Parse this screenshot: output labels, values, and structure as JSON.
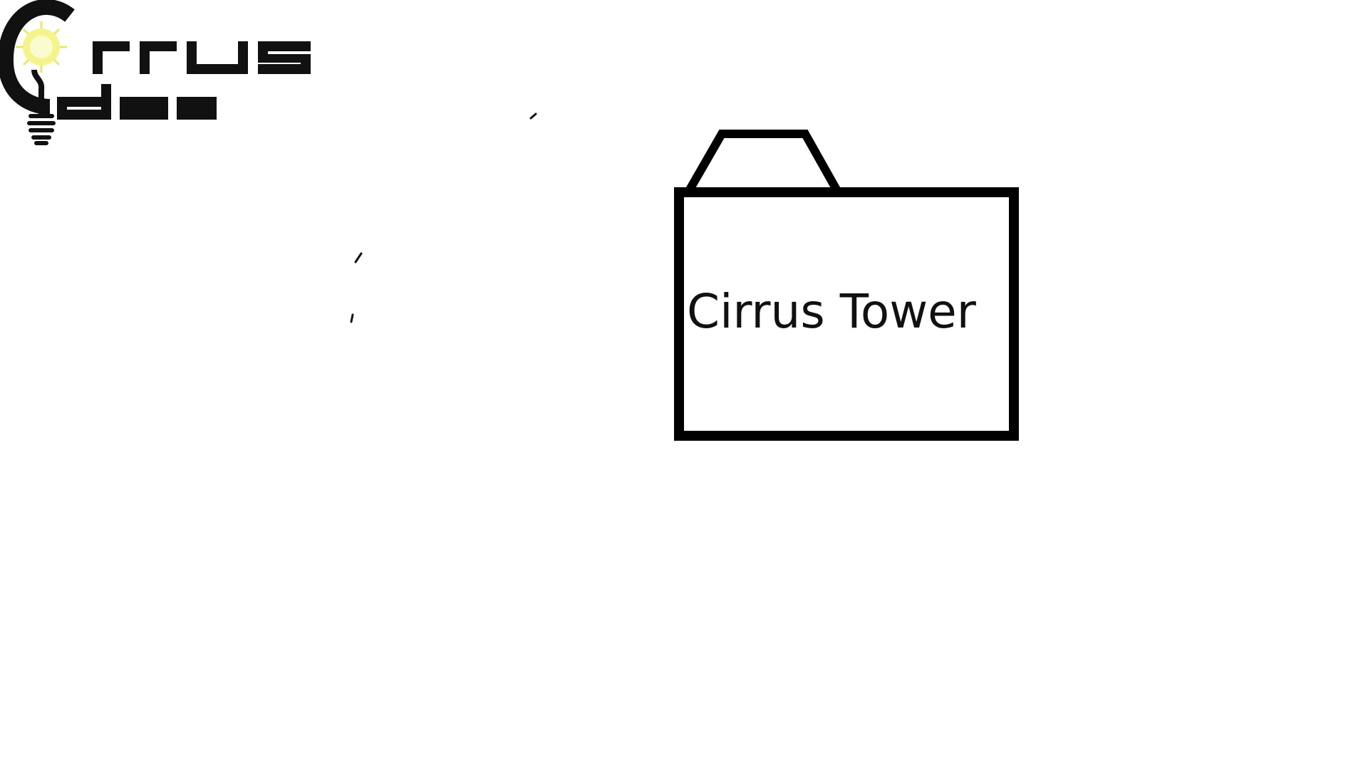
{
  "logo": {
    "text": "Cirrus Idea",
    "line1": "rrus",
    "line2": "dea",
    "colors": {
      "ink": "#111111",
      "bulb_glow": "#f4f48a",
      "bulb_core": "#fbfbd0"
    }
  },
  "folder": {
    "label": "Cirrus Tower",
    "icon": "folder-icon",
    "colors": {
      "stroke": "#000000",
      "fill": "#ffffff",
      "text": "#111111"
    }
  }
}
